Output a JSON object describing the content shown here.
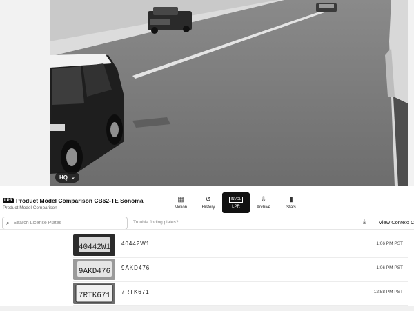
{
  "camera": {
    "tag": "LPR",
    "title": "Product Model Comparison CB62-TE Sonoma",
    "subtitle": "Product Model Comparison",
    "quality_badge": "HQ"
  },
  "tabs": [
    {
      "label": "Motion",
      "icon": "grid-icon",
      "glyph": "▦"
    },
    {
      "label": "History",
      "icon": "history-icon",
      "glyph": "↺"
    },
    {
      "label": "LPR",
      "icon": "lpr-icon",
      "glyph": "INVOL",
      "active": true
    },
    {
      "label": "Archive",
      "icon": "archive-icon",
      "glyph": "⇩"
    },
    {
      "label": "Stats",
      "icon": "stats-icon",
      "glyph": "▮"
    }
  ],
  "search": {
    "placeholder": "Search License Plates"
  },
  "help_text": "Trouble finding plates?",
  "actions": {
    "view_context": "View Context C"
  },
  "plates": [
    {
      "plate": "40442W1",
      "time": "1:06 PM PST",
      "image_text": "40442W1"
    },
    {
      "plate": "9AKD476",
      "time": "1:06 PM PST",
      "image_text": "9AKD476"
    },
    {
      "plate": "7RTK671",
      "time": "12:58 PM PST",
      "image_text": "7RTK671"
    }
  ]
}
